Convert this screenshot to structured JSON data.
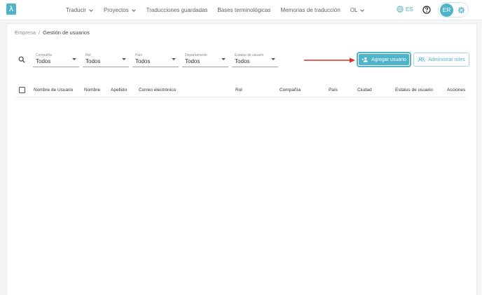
{
  "app": {
    "logo_glyph": "λ",
    "accent": "#4fb3c9",
    "annotation_color": "#d93025"
  },
  "nav": {
    "items": [
      {
        "label": "Traducir",
        "has_menu": true
      },
      {
        "label": "Proyectos",
        "has_menu": true
      },
      {
        "label": "Traducciones guardadas",
        "has_menu": false
      },
      {
        "label": "Bases terminológicas",
        "has_menu": false
      },
      {
        "label": "Memorias de traducción",
        "has_menu": false
      },
      {
        "label": "OL",
        "has_menu": true
      }
    ]
  },
  "header": {
    "language": "ES",
    "user_initials": "ER",
    "icons": [
      "globe-icon",
      "help-icon",
      "gear-icon"
    ]
  },
  "breadcrumb": {
    "root": "Empresa",
    "separator": "/",
    "current": "Gestión de usuarios"
  },
  "filters": [
    {
      "label": "Compañía",
      "value": "Todos"
    },
    {
      "label": "Rol",
      "value": "Todos"
    },
    {
      "label": "País",
      "value": "Todos"
    },
    {
      "label": "Departamento",
      "value": "Todos"
    },
    {
      "label": "Estatus de usuario",
      "value": "Todos"
    }
  ],
  "actions": {
    "add_user": "Agregar usuario",
    "manage_roles": "Administrar roles"
  },
  "table": {
    "columns": [
      "Nombre de Usuario",
      "Nombre",
      "Apellido",
      "Correo electrónico",
      "Rol",
      "Compañía",
      "País",
      "Ciudad",
      "Estatus de usuario",
      "Acciones"
    ],
    "rows": []
  }
}
